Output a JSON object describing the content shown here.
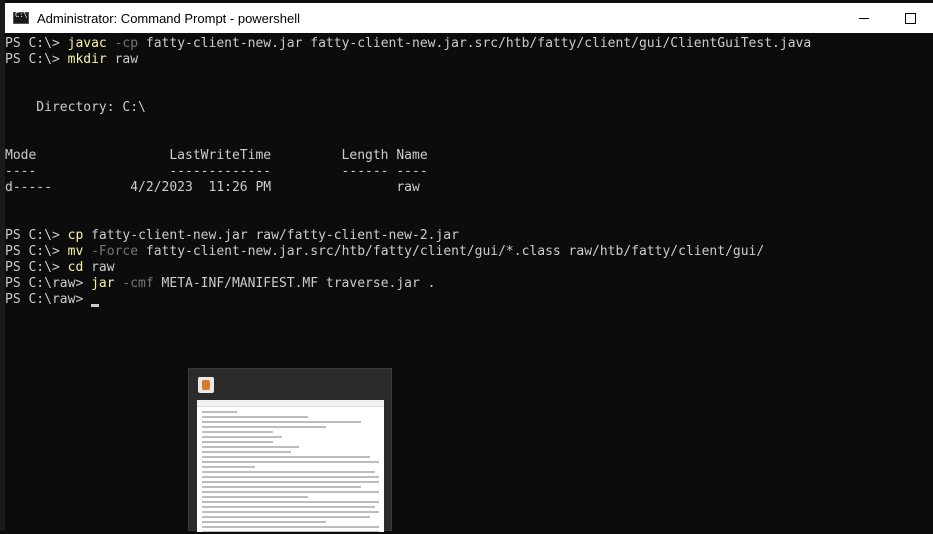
{
  "window": {
    "title": "Administrator: Command Prompt - powershell",
    "controls": [
      "minimize",
      "maximize"
    ]
  },
  "console": {
    "lines": [
      {
        "type": "cmd",
        "prompt": "PS C:\\> ",
        "cmd": "javac",
        "param": " -cp",
        "arg": " fatty-client-new.jar fatty-client-new.jar.src/htb/fatty/client/gui/ClientGuiTest.java"
      },
      {
        "type": "cmd",
        "prompt": "PS C:\\> ",
        "cmd": "mkdir",
        "param": "",
        "arg": " raw"
      },
      {
        "type": "text",
        "text": ""
      },
      {
        "type": "text",
        "text": ""
      },
      {
        "type": "text",
        "text": "    Directory: C:\\"
      },
      {
        "type": "text",
        "text": ""
      },
      {
        "type": "text",
        "text": ""
      },
      {
        "type": "text",
        "text": "Mode                 LastWriteTime         Length Name"
      },
      {
        "type": "text",
        "text": "----                 -------------         ------ ----"
      },
      {
        "type": "text",
        "text": "d-----          4/2/2023  11:26 PM                raw"
      },
      {
        "type": "text",
        "text": ""
      },
      {
        "type": "text",
        "text": ""
      },
      {
        "type": "cmd",
        "prompt": "PS C:\\> ",
        "cmd": "cp",
        "param": "",
        "arg": " fatty-client-new.jar raw/fatty-client-new-2.jar"
      },
      {
        "type": "cmd",
        "prompt": "PS C:\\> ",
        "cmd": "mv",
        "param": " -Force",
        "arg": " fatty-client-new.jar.src/htb/fatty/client/gui/*.class raw/htb/fatty/client/gui/"
      },
      {
        "type": "cmd",
        "prompt": "PS C:\\> ",
        "cmd": "cd",
        "param": "",
        "arg": " raw"
      },
      {
        "type": "cmd",
        "prompt": "PS C:\\raw> ",
        "cmd": "jar",
        "param": " -cmf",
        "arg": " META-INF/MANIFEST.MF traverse.jar ."
      },
      {
        "type": "input",
        "prompt": "PS C:\\raw> "
      }
    ]
  },
  "colors": {
    "background": "#0c0c0c",
    "text": "#cccccc",
    "command": "#f9f1a5",
    "parameter": "#767676"
  },
  "thumbnail": {
    "icon": "java-icon"
  }
}
